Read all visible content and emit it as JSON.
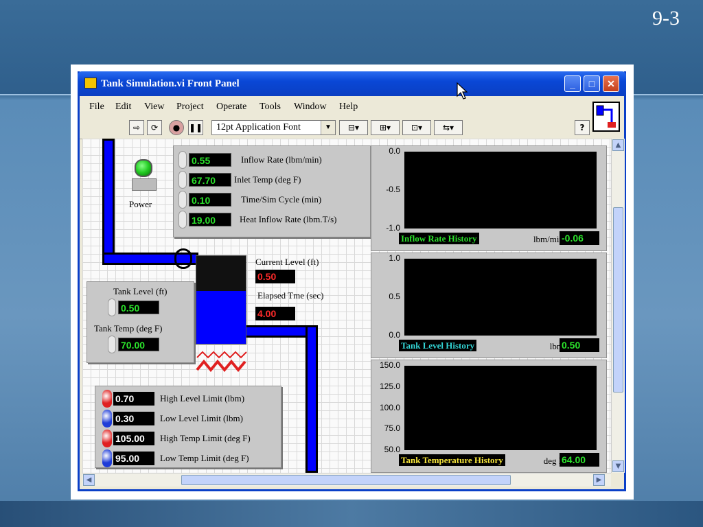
{
  "slide": {
    "number": "9-3"
  },
  "window": {
    "title": "Tank Simulation.vi Front Panel"
  },
  "menu": [
    "File",
    "Edit",
    "View",
    "Project",
    "Operate",
    "Tools",
    "Window",
    "Help"
  ],
  "toolbar": {
    "font": "12pt Application Font",
    "help": "?"
  },
  "power": {
    "label": "Power"
  },
  "controls": [
    {
      "value": "0.55",
      "label": "Inflow Rate (lbm/min)"
    },
    {
      "value": "67.70",
      "label": "Inlet Temp (deg F)"
    },
    {
      "value": "0.10",
      "label": "Time/Sim Cycle (min)"
    },
    {
      "value": "19.00",
      "label": "Heat Inflow Rate (lbm.T/s)"
    }
  ],
  "tank": {
    "level_label": "Tank Level (ft)",
    "level_value": "0.50",
    "temp_label": "Tank Temp (deg F)",
    "temp_value": "70.00",
    "fill_fraction": 0.6
  },
  "indicators": {
    "current_level_label": "Current Level (ft)",
    "current_level_value": "0.50",
    "elapsed_label": "Elapsed Tme (sec)",
    "elapsed_value": "4.00"
  },
  "limits": [
    {
      "value": "0.70",
      "label": "High Level Limit (lbm)",
      "color": "#e02020"
    },
    {
      "value": "0.30",
      "label": "Low Level Limit (lbm)",
      "color": "#1e3cd8"
    },
    {
      "value": "105.00",
      "label": "High Temp Limit (deg F)",
      "color": "#e02020"
    },
    {
      "value": "95.00",
      "label": "Low Temp Limit (deg F)",
      "color": "#1e3cd8"
    }
  ],
  "charts": [
    {
      "title": "Inflow Rate History",
      "unit": "lbm/min",
      "value": "-0.06",
      "ticks": [
        "0.0",
        "-0.5",
        "-1.0"
      ],
      "title_color": "#2be32b"
    },
    {
      "title": "Tank Level History",
      "unit": "lbm",
      "value": "0.50",
      "ticks": [
        "1.0",
        "0.5",
        "0.0"
      ],
      "title_color": "#33d6d6"
    },
    {
      "title": "Tank Temperature History",
      "unit": "deg F",
      "value": "64.00",
      "ticks": [
        "150.0",
        "125.0",
        "100.0",
        "75.0",
        "50.0"
      ],
      "title_color": "#f5e43a"
    }
  ],
  "colors": {
    "pipe": "#0000ff",
    "led": "#22cc22",
    "title_bar": "#0a47d6"
  }
}
